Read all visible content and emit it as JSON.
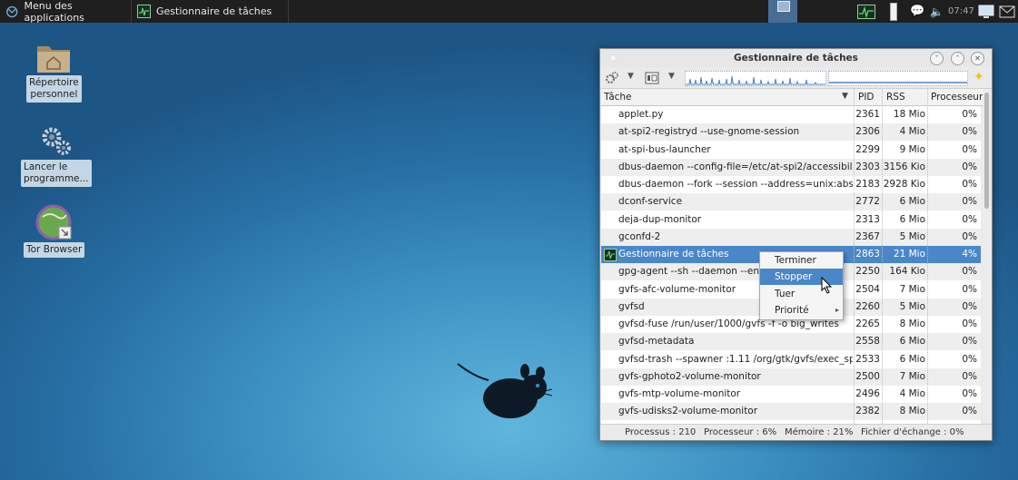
{
  "panel": {
    "apps_menu_label": "Menu des applications",
    "task_label": "Gestionnaire de tâches",
    "clock": "07:47"
  },
  "desktop": {
    "icons": [
      {
        "label_line1": "Répertoire",
        "label_line2": "personnel",
        "icon": "home-folder-icon"
      },
      {
        "label_line1": "Lancer le",
        "label_line2": "programme...",
        "icon": "gears-icon"
      },
      {
        "label_line1": "Tor Browser",
        "label_line2": "",
        "icon": "tor-browser-icon"
      }
    ]
  },
  "window": {
    "title": "Gestionnaire de tâches",
    "columns": {
      "task": "Tâche",
      "pid": "PID",
      "rss": "RSS",
      "cpu": "Processeur"
    },
    "rows": [
      {
        "name": "applet.py",
        "pid": "2361",
        "rss": "18 Mio",
        "cpu": "0%"
      },
      {
        "name": "at-spi2-registryd --use-gnome-session",
        "pid": "2306",
        "rss": "4 Mio",
        "cpu": "0%"
      },
      {
        "name": "at-spi-bus-launcher",
        "pid": "2299",
        "rss": "9 Mio",
        "cpu": "0%"
      },
      {
        "name": "dbus-daemon --config-file=/etc/at-spi2/accessibility.c...",
        "pid": "2303",
        "rss": "3156 Kio",
        "cpu": "0%"
      },
      {
        "name": "dbus-daemon --fork --session --address=unix:abstrac...",
        "pid": "2183",
        "rss": "2928 Kio",
        "cpu": "0%"
      },
      {
        "name": "dconf-service",
        "pid": "2772",
        "rss": "6 Mio",
        "cpu": "0%"
      },
      {
        "name": "deja-dup-monitor",
        "pid": "2313",
        "rss": "6 Mio",
        "cpu": "0%"
      },
      {
        "name": "gconfd-2",
        "pid": "2367",
        "rss": "5 Mio",
        "cpu": "0%"
      },
      {
        "name": "Gestionnaire de tâches",
        "pid": "2863",
        "rss": "21 Mio",
        "cpu": "4%"
      },
      {
        "name": "gpg-agent --sh --daemon --enable",
        "pid": "2250",
        "rss": "164 Kio",
        "cpu": "0%"
      },
      {
        "name": "gvfs-afc-volume-monitor",
        "pid": "2504",
        "rss": "7 Mio",
        "cpu": "0%"
      },
      {
        "name": "gvfsd",
        "pid": "2260",
        "rss": "5 Mio",
        "cpu": "0%"
      },
      {
        "name": "gvfsd-fuse /run/user/1000/gvfs -f -o big_writes",
        "pid": "2265",
        "rss": "8 Mio",
        "cpu": "0%"
      },
      {
        "name": "gvfsd-metadata",
        "pid": "2558",
        "rss": "6 Mio",
        "cpu": "0%"
      },
      {
        "name": "gvfsd-trash --spawner :1.11 /org/gtk/gvfs/exec_spaw/0",
        "pid": "2533",
        "rss": "6 Mio",
        "cpu": "0%"
      },
      {
        "name": "gvfs-gphoto2-volume-monitor",
        "pid": "2500",
        "rss": "7 Mio",
        "cpu": "0%"
      },
      {
        "name": "gvfs-mtp-volume-monitor",
        "pid": "2496",
        "rss": "4 Mio",
        "cpu": "0%"
      },
      {
        "name": "gvfs-udisks2-volume-monitor",
        "pid": "2382",
        "rss": "8 Mio",
        "cpu": "0%"
      }
    ],
    "status": {
      "processes": "Processus : 210",
      "cpu": "Processeur : 6%",
      "memory": "Mémoire : 21%",
      "swap": "Fichier d'échange : 0%"
    }
  },
  "context_menu": {
    "items": [
      "Terminer",
      "Stopper",
      "Tuer",
      "Priorité"
    ],
    "highlighted": "Stopper"
  },
  "colors": {
    "selection": "#4a87c8",
    "panel": "#1f1f1f",
    "desktop": "#3c90c2"
  }
}
